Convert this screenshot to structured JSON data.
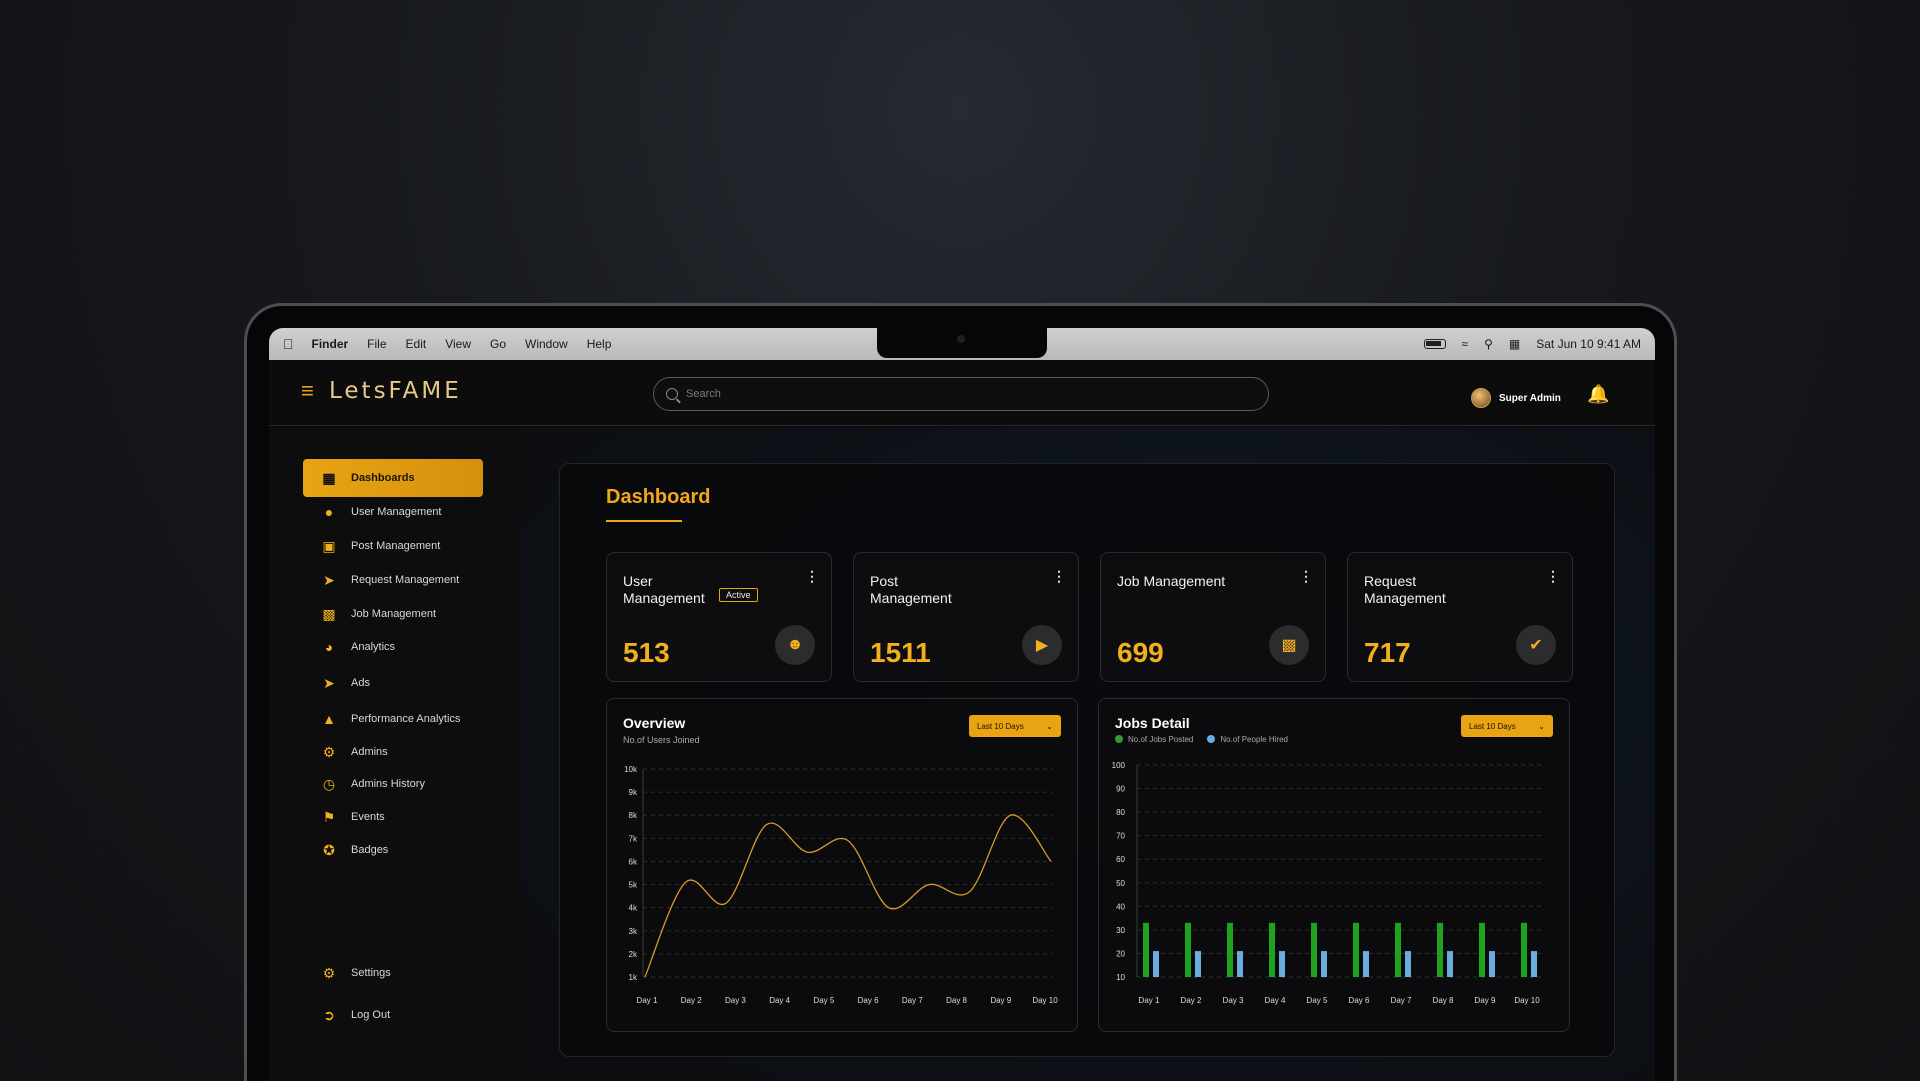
{
  "menubar": {
    "items": [
      "Finder",
      "File",
      "Edit",
      "View",
      "Go",
      "Window",
      "Help"
    ],
    "clock": "Sat Jun 10  9:41 AM"
  },
  "app": {
    "brand": "LetsFAME",
    "search_placeholder": "Search",
    "user_name": "Super Admin",
    "accent": "#f2a71b"
  },
  "sidebar": {
    "items": [
      {
        "label": "Dashboards",
        "icon": "dashboard-icon",
        "active": true
      },
      {
        "label": "User Management",
        "icon": "users-icon"
      },
      {
        "label": "Post Management",
        "icon": "image-icon"
      },
      {
        "label": "Request Management",
        "icon": "request-icon"
      },
      {
        "label": "Job Management",
        "icon": "briefcase-icon"
      },
      {
        "label": "Analytics",
        "icon": "pie-chart-icon"
      },
      {
        "label": "Ads",
        "icon": "megaphone-icon"
      },
      {
        "label": "Performance Analytics",
        "icon": "performance-icon"
      },
      {
        "label": "Admins",
        "icon": "admins-icon"
      },
      {
        "label": "Admins History",
        "icon": "admin-history-icon"
      },
      {
        "label": "Events",
        "icon": "flag-icon"
      },
      {
        "label": "Badges",
        "icon": "badge-icon"
      }
    ],
    "bottom": [
      {
        "label": "Settings",
        "icon": "gear-icon"
      },
      {
        "label": "Log Out",
        "icon": "logout-icon"
      }
    ]
  },
  "dashboard": {
    "title": "Dashboard",
    "cards": [
      {
        "title": "User Management",
        "badge": "Active",
        "value": "513",
        "icon": "user-gear-icon"
      },
      {
        "title": "Post Management",
        "badge": "",
        "value": "1511",
        "icon": "video-gear-icon"
      },
      {
        "title": "Job Management",
        "badge": "",
        "value": "699",
        "icon": "briefcase-gear-icon"
      },
      {
        "title": "Request Management",
        "badge": "",
        "value": "717",
        "icon": "badge-check-icon"
      }
    ],
    "overview": {
      "title": "Overview",
      "subtitle": "No.of Users Joined",
      "range": "Last 10 Days"
    },
    "jobs": {
      "title": "Jobs Detail",
      "range": "Last 10 Days"
    }
  },
  "chart_data": [
    {
      "type": "line",
      "title": "Overview",
      "subtitle": "No.of Users Joined",
      "x": [
        "Day 1",
        "Day 2",
        "Day 3",
        "Day 4",
        "Day 5",
        "Day 6",
        "Day 7",
        "Day 8",
        "Day 9",
        "Day 10"
      ],
      "y_ticks": [
        "1k",
        "2k",
        "3k",
        "4k",
        "5k",
        "6k",
        "7k",
        "8k",
        "9k",
        "10k"
      ],
      "ylim": [
        1000,
        10000
      ],
      "series": [
        {
          "values": [
            1000,
            5100,
            4200,
            7600,
            6400,
            6900,
            4000,
            5000,
            4700,
            8000,
            6000
          ]
        }
      ],
      "x_positions": [
        0,
        1,
        2,
        3,
        4,
        5,
        6,
        7,
        8,
        9,
        10
      ],
      "color": "#d69a2a",
      "grid": "dashed horizontal"
    },
    {
      "type": "bar",
      "title": "Jobs Detail",
      "categories": [
        "Day 1",
        "Day 2",
        "Day 3",
        "Day 4",
        "Day 5",
        "Day 6",
        "Day 7",
        "Day 8",
        "Day 9",
        "Day 10"
      ],
      "y_ticks": [
        10,
        20,
        30,
        40,
        50,
        60,
        70,
        80,
        90,
        100
      ],
      "ylim": [
        10,
        100
      ],
      "series": [
        {
          "name": "No.of Jobs Posted",
          "color": "#1fa21f",
          "values": [
            33,
            33,
            33,
            33,
            33,
            33,
            33,
            33,
            33,
            33
          ]
        },
        {
          "name": "No.of People Hired",
          "color": "#6aaee0",
          "values": [
            21,
            21,
            21,
            21,
            21,
            21,
            21,
            21,
            21,
            21
          ]
        }
      ],
      "grid": "dashed horizontal",
      "legend": "top-left"
    }
  ]
}
